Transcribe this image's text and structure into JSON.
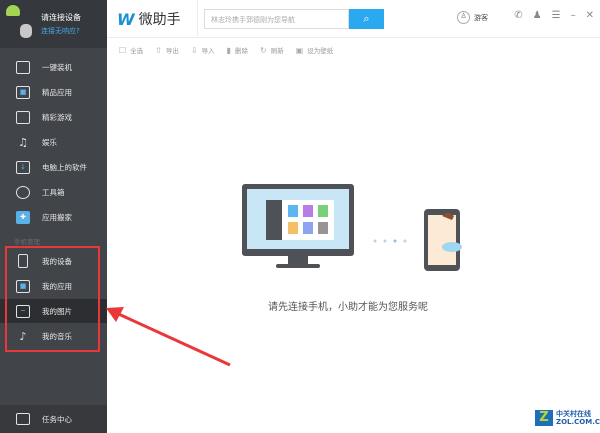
{
  "device": {
    "title": "请连接设备",
    "help_link": "连接无响应?"
  },
  "sidebar": {
    "items": [
      {
        "label": "一键装机",
        "icon": "folder-icon"
      },
      {
        "label": "精品应用",
        "icon": "apps-icon"
      },
      {
        "label": "精彩游戏",
        "icon": "gamepad-icon"
      },
      {
        "label": "娱乐",
        "icon": "music-icon"
      },
      {
        "label": "电脑上的软件",
        "icon": "download-icon"
      },
      {
        "label": "工具箱",
        "icon": "tools-icon"
      },
      {
        "label": "应用搬家",
        "icon": "move-icon"
      }
    ],
    "section_label": "手机管理",
    "phone_items": [
      {
        "label": "我的设备",
        "icon": "phone-icon"
      },
      {
        "label": "我的应用",
        "icon": "apps-icon"
      },
      {
        "label": "我的图片",
        "icon": "image-icon",
        "active": true
      },
      {
        "label": "我的音乐",
        "icon": "music-list-icon"
      }
    ],
    "task_center": "任务中心"
  },
  "header": {
    "app_name": "微助手",
    "search_placeholder": "林志玲携手郭德刚为您导航",
    "user": "游客"
  },
  "toolbar": {
    "select_all": "全选",
    "export": "导出",
    "import": "导入",
    "delete": "删除",
    "refresh": "刷新",
    "set_wallpaper": "设为壁纸"
  },
  "main": {
    "message": "请先连接手机，小助才能为您服务呢"
  },
  "colors": {
    "accent": "#2aa8f0",
    "annotation": "#e8383a"
  },
  "watermark": {
    "cn": "中关村在线",
    "en": "ZOL.COM.CN"
  }
}
